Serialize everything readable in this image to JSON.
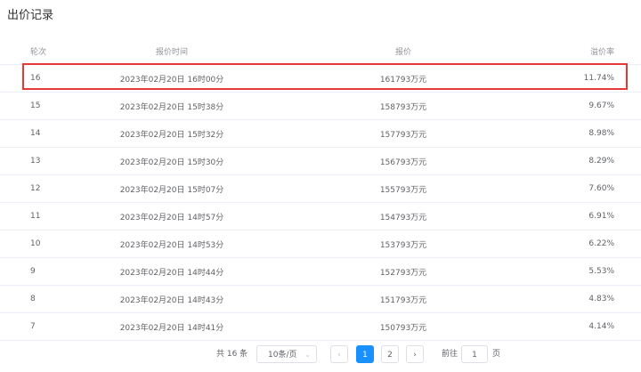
{
  "title": "出价记录",
  "columns": [
    "轮次",
    "报价时间",
    "报价",
    "溢价率"
  ],
  "rows": [
    {
      "round": "16",
      "time": "2023年02月20日 16时00分",
      "price": "161793万元",
      "premium": "11.74%"
    },
    {
      "round": "15",
      "time": "2023年02月20日 15时38分",
      "price": "158793万元",
      "premium": "9.67%"
    },
    {
      "round": "14",
      "time": "2023年02月20日 15时32分",
      "price": "157793万元",
      "premium": "8.98%"
    },
    {
      "round": "13",
      "time": "2023年02月20日 15时30分",
      "price": "156793万元",
      "premium": "8.29%"
    },
    {
      "round": "12",
      "time": "2023年02月20日 15时07分",
      "price": "155793万元",
      "premium": "7.60%"
    },
    {
      "round": "11",
      "time": "2023年02月20日 14时57分",
      "price": "154793万元",
      "premium": "6.91%"
    },
    {
      "round": "10",
      "time": "2023年02月20日 14时53分",
      "price": "153793万元",
      "premium": "6.22%"
    },
    {
      "round": "9",
      "time": "2023年02月20日 14时44分",
      "price": "152793万元",
      "premium": "5.53%"
    },
    {
      "round": "8",
      "time": "2023年02月20日 14时43分",
      "price": "151793万元",
      "premium": "4.83%"
    },
    {
      "round": "7",
      "time": "2023年02月20日 14时41分",
      "price": "150793万元",
      "premium": "4.14%"
    }
  ],
  "pagination": {
    "total_label": "共 16 条",
    "page_size_label": "10条/页",
    "prev_symbol": "‹",
    "next_symbol": "›",
    "pages": [
      "1",
      "2"
    ],
    "current_page": "1",
    "goto_label": "前往",
    "goto_value": "1",
    "goto_unit": "页"
  },
  "colors": {
    "highlight": "#e53935",
    "accent": "#1890ff"
  }
}
